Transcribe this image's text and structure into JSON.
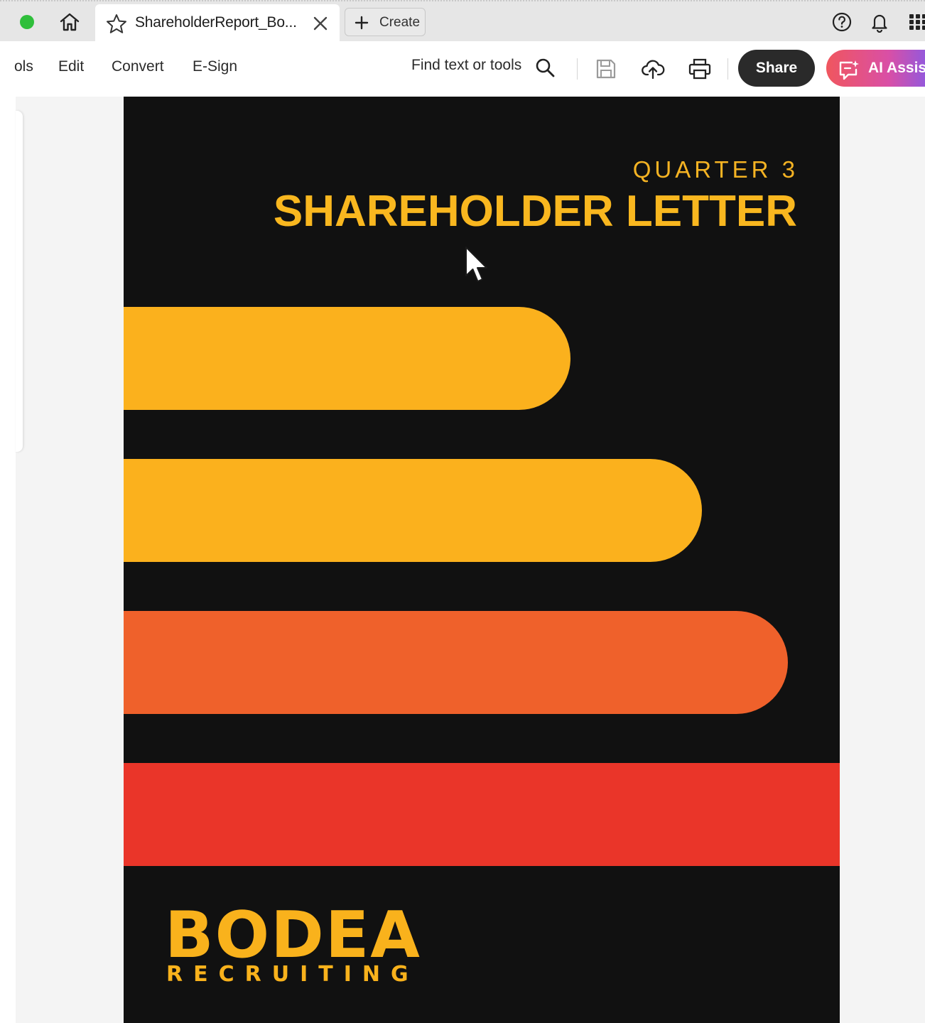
{
  "tabbar": {
    "tab_title": "ShareholderReport_Bo...",
    "create_label": "Create"
  },
  "toolbar": {
    "menu_items": [
      "ols",
      "Edit",
      "Convert",
      "E-Sign"
    ],
    "find_label": "Find text or tools",
    "share_label": "Share",
    "ai_label": "AI Assist"
  },
  "document": {
    "quarter": "QUARTER 3",
    "headline": "SHAREHOLDER LETTER",
    "brand_name": "BODEA",
    "brand_sub": "RECRUITING"
  },
  "colors": {
    "page_bg": "#111111",
    "yellow": "#fbb11d",
    "orange": "#ef612b",
    "red": "#ea3529",
    "share_bg": "#2a2a2a"
  },
  "icons": {
    "window": "green-dot-icon",
    "home": "home-icon",
    "favorite": "star-icon",
    "close": "close-icon",
    "create": "plus-icon",
    "help": "help-icon",
    "notifications": "bell-icon",
    "apps": "apps-grid-icon",
    "search": "search-icon",
    "save": "save-icon",
    "upload": "cloud-upload-icon",
    "print": "print-icon",
    "ai": "ai-assistant-icon"
  }
}
